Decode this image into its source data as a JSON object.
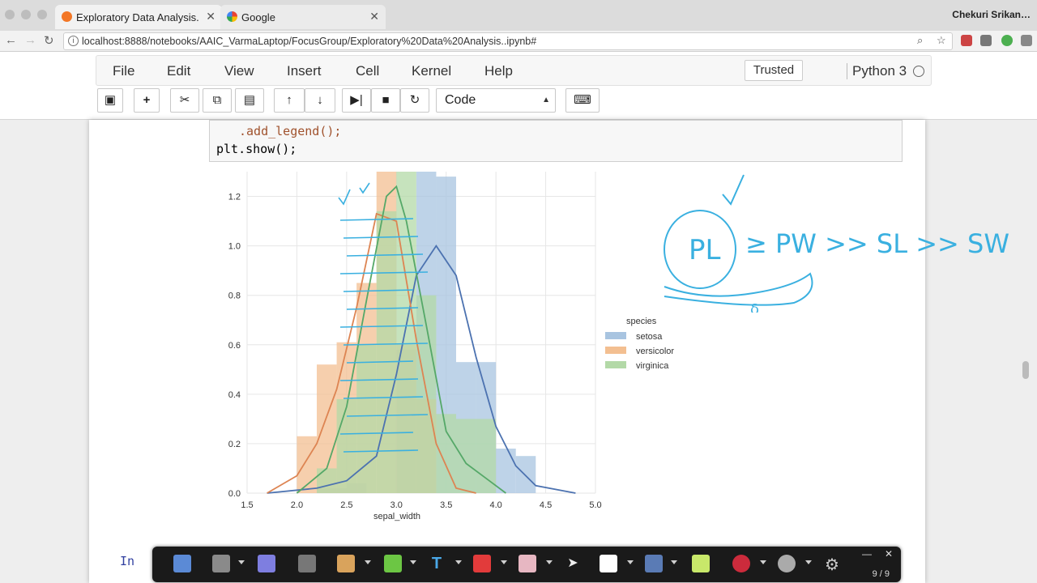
{
  "browser": {
    "tabs": [
      {
        "title": "Exploratory Data Analysis.",
        "active": true
      },
      {
        "title": "Google",
        "active": false
      }
    ],
    "profile": "Chekuri Srikan…",
    "url": "localhost:8888/notebooks/AAIC_VarmaLaptop/FocusGroup/Exploratory%20Data%20Analysis..ipynb#"
  },
  "notebook": {
    "menu": [
      "File",
      "Edit",
      "View",
      "Insert",
      "Cell",
      "Kernel",
      "Help"
    ],
    "trusted_label": "Trusted",
    "kernel_name": "Python 3",
    "cell_type": "Code",
    "code_lines": [
      ".add_legend();",
      "plt.show();"
    ],
    "next_prompt": "In"
  },
  "chart_data": {
    "type": "histogram",
    "xlabel": "sepal_width",
    "xticks": [
      "1.5",
      "2.0",
      "2.5",
      "3.0",
      "3.5",
      "4.0",
      "4.5",
      "5.0"
    ],
    "yticks": [
      "0.0",
      "0.2",
      "0.4",
      "0.6",
      "0.8",
      "1.0",
      "1.2"
    ],
    "xlim": [
      1.5,
      5.0
    ],
    "ylim": [
      0,
      1.3
    ],
    "grid": true,
    "legend_title": "species",
    "legend_position": "right",
    "series": [
      {
        "name": "setosa",
        "color": "#a8c4e0",
        "bins": [
          [
            2.2,
            2.5,
            0.02
          ],
          [
            2.5,
            2.7,
            0.04
          ],
          [
            3.0,
            3.2,
            0.58
          ],
          [
            3.2,
            3.4,
            1.3
          ],
          [
            3.4,
            3.6,
            1.28
          ],
          [
            3.6,
            3.8,
            0.53
          ],
          [
            3.8,
            4.0,
            0.53
          ],
          [
            4.0,
            4.2,
            0.18
          ],
          [
            4.2,
            4.4,
            0.15
          ]
        ],
        "kde": [
          [
            1.7,
            0
          ],
          [
            2.2,
            0.02
          ],
          [
            2.5,
            0.05
          ],
          [
            2.8,
            0.15
          ],
          [
            3.0,
            0.48
          ],
          [
            3.2,
            0.88
          ],
          [
            3.4,
            1.0
          ],
          [
            3.6,
            0.88
          ],
          [
            3.8,
            0.55
          ],
          [
            4.0,
            0.27
          ],
          [
            4.2,
            0.11
          ],
          [
            4.4,
            0.03
          ],
          [
            4.8,
            0
          ]
        ]
      },
      {
        "name": "versicolor",
        "color": "#f3bf91",
        "bins": [
          [
            2.0,
            2.2,
            0.23
          ],
          [
            2.2,
            2.4,
            0.52
          ],
          [
            2.4,
            2.6,
            0.61
          ],
          [
            2.6,
            2.8,
            0.85
          ],
          [
            2.8,
            3.0,
            1.35
          ],
          [
            3.0,
            3.2,
            0.6
          ],
          [
            3.2,
            3.4,
            0.38
          ]
        ],
        "kde": [
          [
            1.7,
            0
          ],
          [
            2.0,
            0.07
          ],
          [
            2.2,
            0.2
          ],
          [
            2.4,
            0.42
          ],
          [
            2.6,
            0.75
          ],
          [
            2.8,
            1.13
          ],
          [
            3.0,
            1.1
          ],
          [
            3.2,
            0.62
          ],
          [
            3.4,
            0.2
          ],
          [
            3.6,
            0.02
          ],
          [
            3.8,
            0
          ]
        ]
      },
      {
        "name": "virginica",
        "color": "#b3d9a7",
        "bins": [
          [
            2.2,
            2.4,
            0.1
          ],
          [
            2.4,
            2.6,
            0.38
          ],
          [
            2.6,
            2.8,
            0.6
          ],
          [
            2.8,
            3.0,
            1.14
          ],
          [
            3.0,
            3.2,
            1.35
          ],
          [
            3.2,
            3.4,
            0.8
          ],
          [
            3.4,
            3.6,
            0.32
          ],
          [
            3.6,
            3.8,
            0.3
          ],
          [
            3.8,
            4.0,
            0.3
          ]
        ],
        "kde": [
          [
            2.0,
            0
          ],
          [
            2.3,
            0.1
          ],
          [
            2.5,
            0.35
          ],
          [
            2.7,
            0.78
          ],
          [
            2.9,
            1.2
          ],
          [
            3.0,
            1.24
          ],
          [
            3.1,
            1.1
          ],
          [
            3.3,
            0.68
          ],
          [
            3.5,
            0.25
          ],
          [
            3.7,
            0.12
          ],
          [
            3.9,
            0.06
          ],
          [
            4.1,
            0
          ]
        ]
      }
    ]
  },
  "annotation": {
    "text": "≥ PW >> SL >> SW",
    "circled": "PL",
    "brace_mark": "δ"
  },
  "ann_toolbar": {
    "page_indicator": "9 / 9"
  }
}
